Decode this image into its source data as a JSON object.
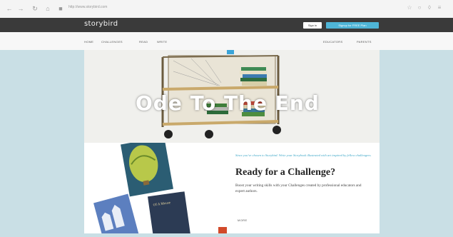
{
  "browser": {
    "url": "http://www.storybird.com"
  },
  "header": {
    "logo": "storybird",
    "signin_label": "Sign in",
    "signup_label": "Signup for FREE Plan"
  },
  "menu": {
    "left_items": [
      "HOME",
      "CHALLENGES",
      "READ",
      "WRITE"
    ],
    "right_items": [
      "EDUCATORS",
      "PARENTS"
    ]
  },
  "hero": {
    "title": "Ode To The End"
  },
  "challenge": {
    "tagline": "Since you've chosen to Storybird. Write your Storybook illustrated with art inspired by fellow challengers.",
    "headline": "Ready for a Challenge?",
    "description": "Boost your writing skills with your Challenges created by professional educators and expert authors.",
    "more_label": "MORE"
  },
  "colors": {
    "accent": "#4fb5d7",
    "dark_bar": "#3a3a3a",
    "page_bg": "#c9dfe5"
  }
}
